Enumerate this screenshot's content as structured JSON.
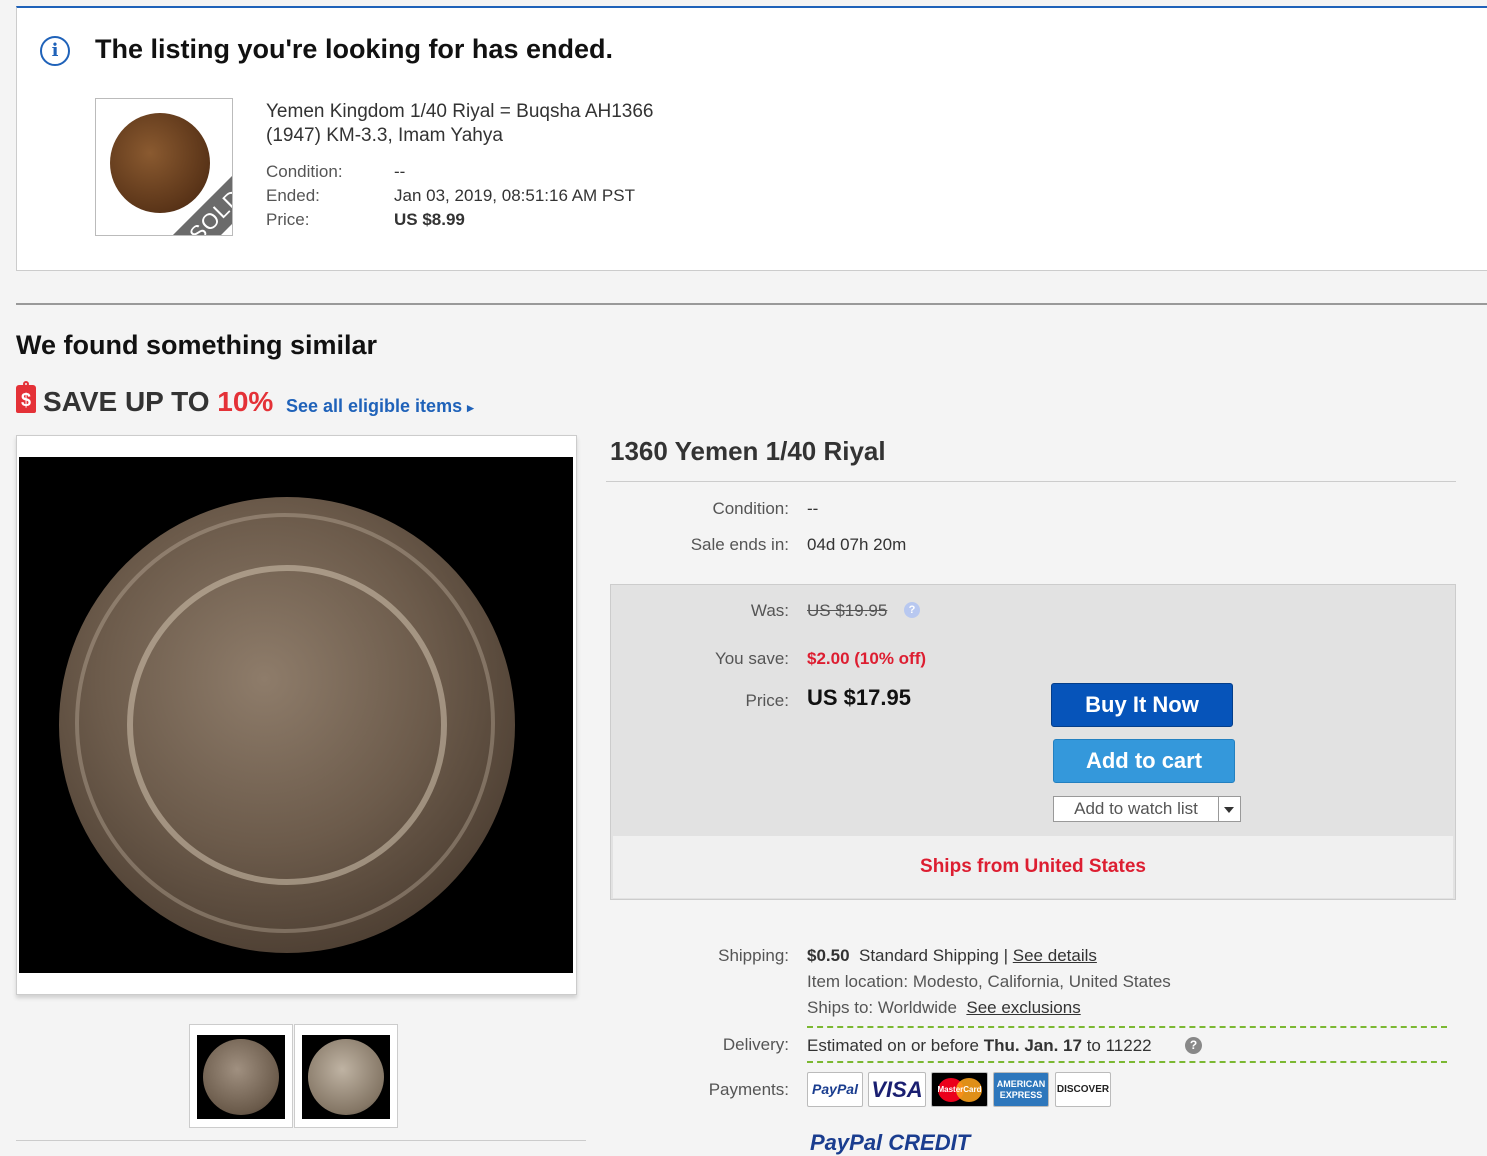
{
  "ended": {
    "title": "The listing you're looking for has ended.",
    "sold_badge": "SOLD",
    "item_title": "Yemen Kingdom 1/40 Riyal = Buqsha AH1366 (1947) KM-3.3, Imam Yahya",
    "condition_label": "Condition:",
    "condition_value": "--",
    "ended_label": "Ended:",
    "ended_value": "Jan 03, 2019, 08:51:16 AM PST",
    "price_label": "Price:",
    "price_value": "US $8.99"
  },
  "similar": {
    "heading": "We found something similar",
    "save_prefix": "SAVE UP TO ",
    "save_pct": "10%",
    "see_all": "See all eligible items",
    "see_all_arrow": "▸",
    "tag_symbol": "$"
  },
  "item": {
    "title": "1360 Yemen 1/40 Riyal",
    "condition_label": "Condition:",
    "condition_value": "--",
    "sale_ends_label": "Sale ends in:",
    "sale_ends_value": "04d 07h 20m",
    "was_label": "Was:",
    "was_value": "US $19.95",
    "you_save_label": "You save:",
    "you_save_value": "$2.00 (10% off)",
    "price_label": "Price:",
    "price_value": "US $17.95",
    "buy_now": "Buy It Now",
    "add_to_cart": "Add to cart",
    "add_to_watch": "Add to watch list",
    "ships_from": "Ships from United States",
    "shipping_label": "Shipping:",
    "shipping_cost": "$0.50",
    "shipping_method": "Standard Shipping |",
    "see_details": "See details",
    "item_location": "Item location: Modesto, California, United States",
    "ships_to": "Ships to: Worldwide",
    "see_exclusions": "See exclusions",
    "delivery_label": "Delivery:",
    "delivery_prefix": "Estimated on or before ",
    "delivery_date": "Thu. Jan. 17",
    "delivery_suffix": " to 11222",
    "payments_label": "Payments:",
    "payments": [
      "PayPal",
      "VISA",
      "MasterCard",
      "AMERICAN EXPRESS",
      "DISCOVER"
    ],
    "paypal_credit": "PayPal CREDIT"
  },
  "colors": {
    "accent_blue": "#0654ba",
    "sale_red": "#dd1e31",
    "link_blue": "#1f62b9"
  }
}
